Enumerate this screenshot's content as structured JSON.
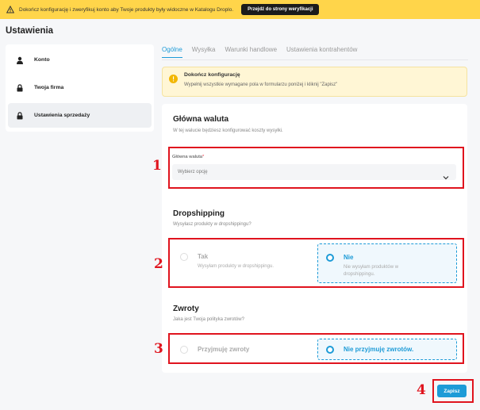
{
  "banner": {
    "text": "Dokończ konfigurację i zweryfikuj konto aby Twoje produkty były widoczne w Katalogu Droplo.",
    "button": "Przejdź do strony weryfikacji"
  },
  "page_title": "Ustawienia",
  "sidebar": {
    "items": [
      {
        "label": "Konto",
        "icon": "person-icon"
      },
      {
        "label": "Twoja firma",
        "icon": "lock-icon"
      },
      {
        "label": "Ustawienia sprzedaży",
        "icon": "lock-icon"
      }
    ]
  },
  "tabs": [
    {
      "label": "Ogólne"
    },
    {
      "label": "Wysyłka"
    },
    {
      "label": "Warunki handlowe"
    },
    {
      "label": "Ustawienia kontrahentów"
    }
  ],
  "alert": {
    "title": "Dokończ konfigurację",
    "desc": "Wypełnij wszystkie wymagane pola w formularzu poniżej i kliknij \"Zapisz\""
  },
  "currency": {
    "title": "Główna waluta",
    "desc": "W tej walucie będziesz konfigurować koszty wysyłki.",
    "field_label": "Główna waluta",
    "required_mark": "*",
    "placeholder": "Wybierz opcję"
  },
  "dropshipping": {
    "title": "Dropshipping",
    "desc": "Wysyłasz produkty w dropshippingu?",
    "options": [
      {
        "title": "Tak",
        "desc": "Wysyłam produkty w dropshippingu.",
        "selected": false
      },
      {
        "title": "Nie",
        "desc": "Nie wysyłam produktów w dropshippingu.",
        "selected": true
      }
    ]
  },
  "returns": {
    "title": "Zwroty",
    "desc": "Jaka jest Twoja polityka zwrotów?",
    "options": [
      {
        "title": "Przyjmuję zwroty",
        "selected": false
      },
      {
        "title": "Nie przyjmuję zwrotów.",
        "selected": true
      }
    ]
  },
  "annotations": [
    "1",
    "2",
    "3",
    "4"
  ],
  "save_label": "Zapisz",
  "colors": {
    "accent": "#1d9bd7",
    "annotation": "#e0141e",
    "banner": "#ffd54a"
  }
}
